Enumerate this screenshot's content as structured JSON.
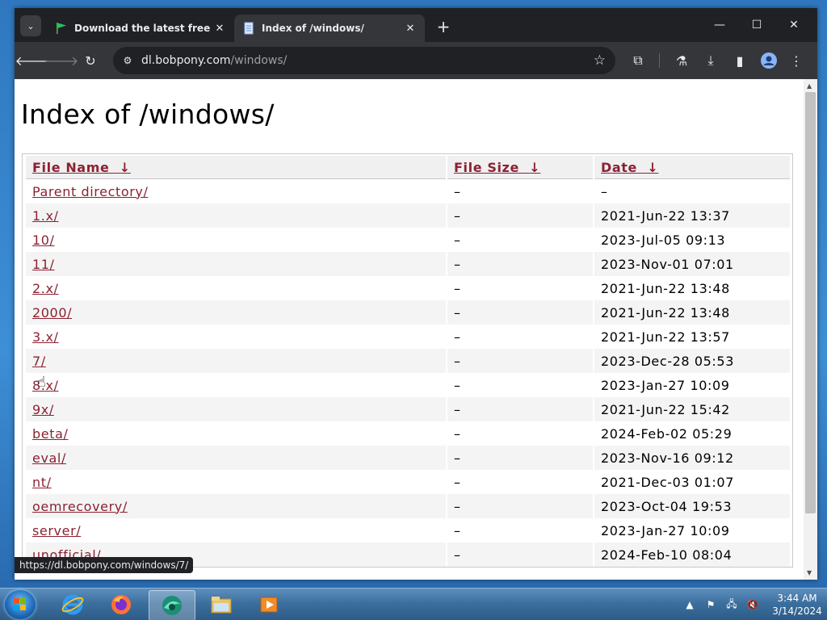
{
  "browser": {
    "tabs": [
      {
        "title": "Download the latest free trial v",
        "active": false
      },
      {
        "title": "Index of /windows/",
        "active": true
      }
    ],
    "url_domain": "dl.bobpony.com",
    "url_path": "/windows/",
    "status_url": "https://dl.bobpony.com/windows/7/"
  },
  "page": {
    "title": "Index of /windows/",
    "columns": [
      "File Name",
      "File Size",
      "Date"
    ],
    "sort_arrow": "↓",
    "rows": [
      {
        "name": "Parent directory/",
        "size": "–",
        "date": "–"
      },
      {
        "name": "1.x/",
        "size": "–",
        "date": "2021-Jun-22 13:37"
      },
      {
        "name": "10/",
        "size": "–",
        "date": "2023-Jul-05 09:13"
      },
      {
        "name": "11/",
        "size": "–",
        "date": "2023-Nov-01 07:01"
      },
      {
        "name": "2.x/",
        "size": "–",
        "date": "2021-Jun-22 13:48"
      },
      {
        "name": "2000/",
        "size": "–",
        "date": "2021-Jun-22 13:48"
      },
      {
        "name": "3.x/",
        "size": "–",
        "date": "2021-Jun-22 13:57"
      },
      {
        "name": "7/",
        "size": "–",
        "date": "2023-Dec-28 05:53"
      },
      {
        "name": "8.x/",
        "size": "–",
        "date": "2023-Jan-27 10:09"
      },
      {
        "name": "9x/",
        "size": "–",
        "date": "2021-Jun-22 15:42"
      },
      {
        "name": "beta/",
        "size": "–",
        "date": "2024-Feb-02 05:29"
      },
      {
        "name": "eval/",
        "size": "–",
        "date": "2023-Nov-16 09:12"
      },
      {
        "name": "nt/",
        "size": "–",
        "date": "2021-Dec-03 01:07"
      },
      {
        "name": "oemrecovery/",
        "size": "–",
        "date": "2023-Oct-04 19:53"
      },
      {
        "name": "server/",
        "size": "–",
        "date": "2023-Jan-27 10:09"
      },
      {
        "name": "unofficial/",
        "size": "–",
        "date": "2024-Feb-10 08:04"
      }
    ]
  },
  "taskbar": {
    "apps": [
      "internet-explorer",
      "firefox",
      "browser-active",
      "file-explorer",
      "media-player"
    ],
    "time": "3:44 AM",
    "date": "3/14/2024"
  },
  "colors": {
    "link": "#8b2232",
    "chrome_dark": "#202124",
    "chrome_toolbar": "#35363a",
    "taskbar": "#3c6f9e"
  }
}
